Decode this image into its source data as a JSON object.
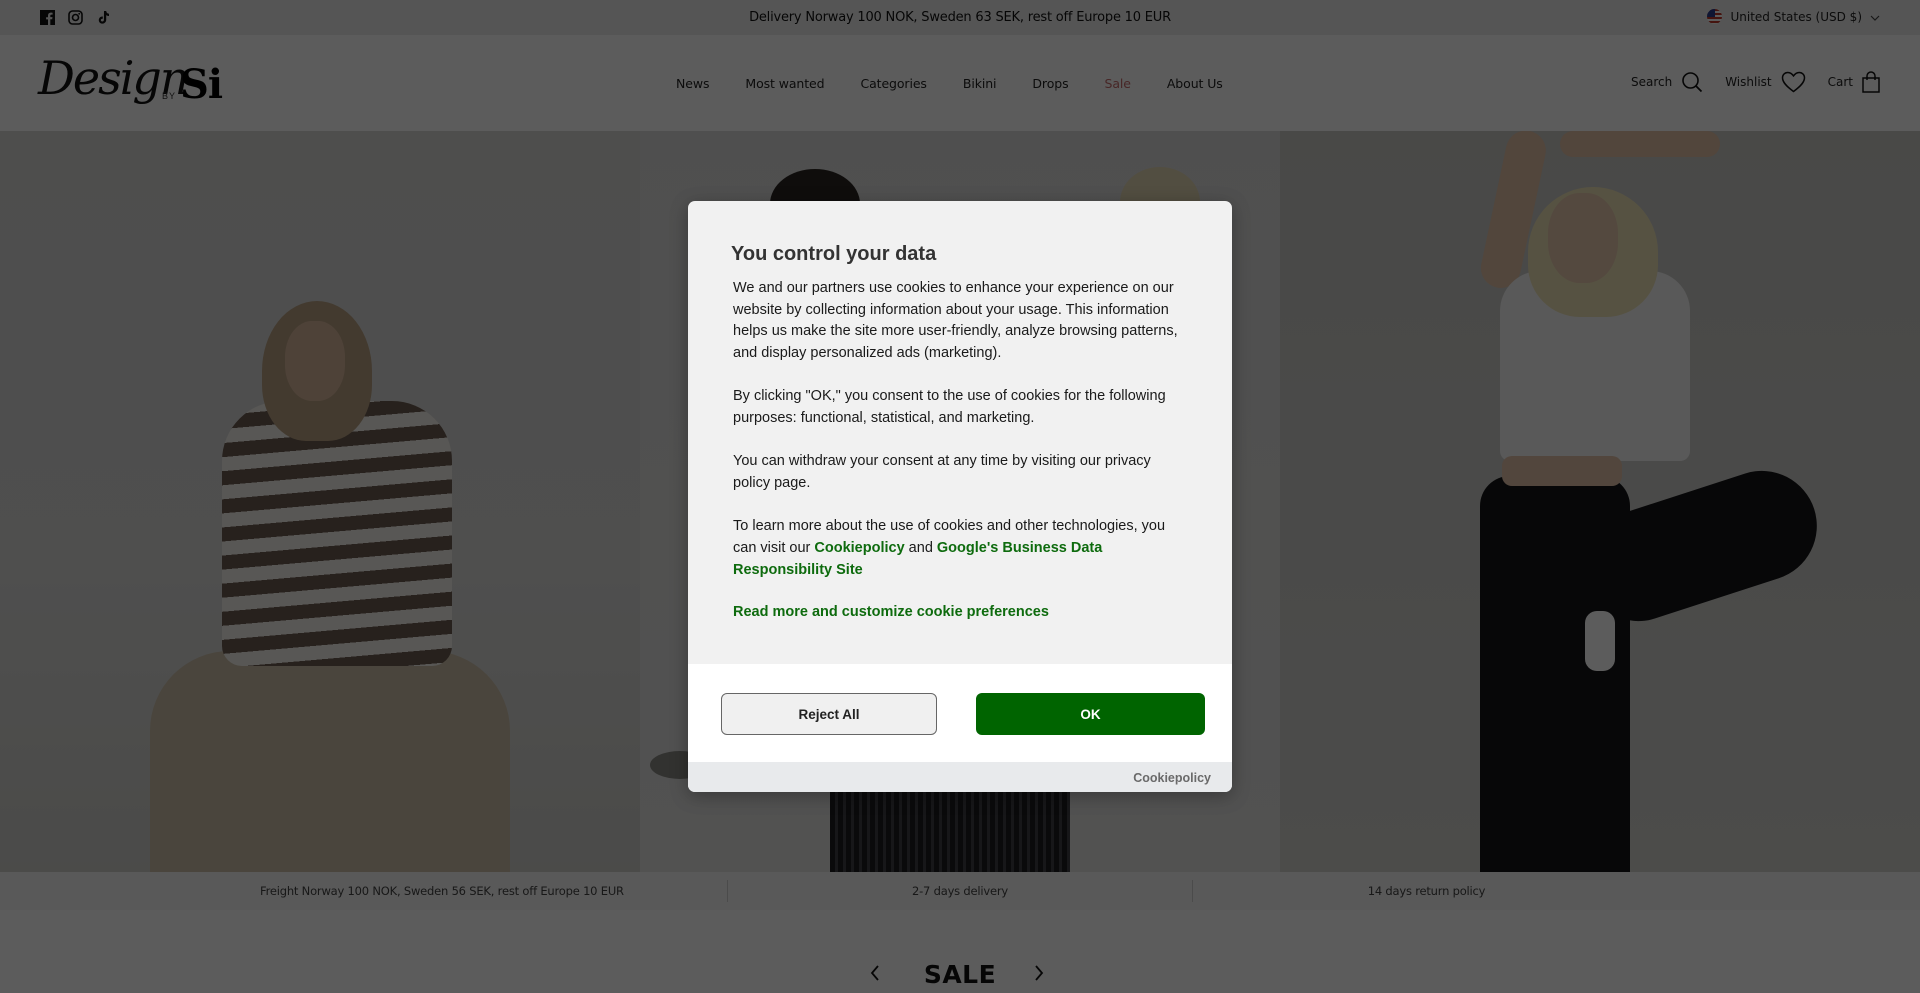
{
  "announcement_bar": {
    "social_icons": [
      {
        "name": "facebook-icon",
        "label": "Facebook"
      },
      {
        "name": "instagram-icon",
        "label": "Instagram"
      },
      {
        "name": "tiktok-icon",
        "label": "TikTok"
      }
    ],
    "message": "Delivery Norway 100 NOK, Sweden 63 SEK, rest off Europe 10 EUR",
    "locale": {
      "flag_icon": "us-flag-icon",
      "label": "United States (USD $)",
      "chevron_icon": "chevron-down-icon"
    }
  },
  "header": {
    "logo": {
      "script": "Design",
      "by": "BY",
      "mark": "Si"
    },
    "nav": [
      {
        "label": "News"
      },
      {
        "label": "Most wanted"
      },
      {
        "label": "Categories"
      },
      {
        "label": "Bikini"
      },
      {
        "label": "Drops"
      },
      {
        "label": "Sale",
        "highlight_color": "#c46a6a"
      },
      {
        "label": "About Us"
      }
    ],
    "actions": {
      "search": {
        "label": "Search",
        "icon": "search-icon"
      },
      "wishlist": {
        "label": "Wishlist",
        "icon": "heart-icon"
      },
      "cart": {
        "label": "Cart",
        "icon": "shopping-bag-icon"
      }
    }
  },
  "hero": {
    "slides": [
      {
        "description": "Model in striped sweater and beige pants sitting on stool"
      },
      {
        "description": "Two models in striped pants"
      },
      {
        "description": "Model in white crop top and black pants posing"
      }
    ]
  },
  "features_bar": {
    "items": [
      "Freight Norway 100 NOK, Sweden 56 SEK, rest off Europe 10 EUR",
      "2-7 days delivery",
      "14 days return policy"
    ]
  },
  "sale_section": {
    "heading": "SALE",
    "prev_icon": "chevron-left-icon",
    "next_icon": "chevron-right-icon"
  },
  "cookie_modal": {
    "title": "You control your data",
    "paragraph_1": "We and our partners use cookies to enhance your experience on our website by collecting information about your usage. This information helps us make the site more user-friendly, analyze browsing patterns, and display personalized ads (marketing).",
    "paragraph_2": "By clicking \"OK,\" you consent to the use of cookies for the following purposes: functional, statistical, and marketing.",
    "paragraph_3": "You can withdraw your consent at any time by visiting our privacy policy page.",
    "paragraph_4_prefix": "To learn more about the use of cookies and other technologies, you can visit our ",
    "cookiepolicy_link": "Cookiepolicy",
    "paragraph_4_and": " and ",
    "google_link": "Google's Business Data Responsibility Site",
    "customize_link": "Read more and customize cookie preferences",
    "reject_button": "Reject All",
    "ok_button": "OK",
    "footer_link": "Cookiepolicy",
    "colors": {
      "accent": "#006400",
      "link": "#0e6b0e",
      "background": "#f1f1f1"
    }
  }
}
